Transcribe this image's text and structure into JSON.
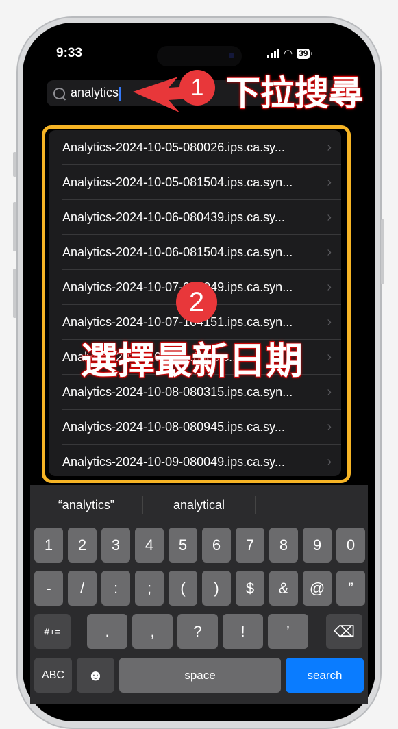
{
  "status_bar": {
    "time": "9:33",
    "battery": "39"
  },
  "search": {
    "value": "analytics"
  },
  "results": [
    "Analytics-2024-10-05-080026.ips.ca.sy...",
    "Analytics-2024-10-05-081504.ips.ca.syn...",
    "Analytics-2024-10-06-080439.ips.ca.sy...",
    "Analytics-2024-10-06-081504.ips.ca.syn...",
    "Analytics-2024-10-07-080049.ips.ca.syn...",
    "Analytics-2024-10-07-104151.ips.ca.syn...",
    "Analytics-2024-10-07-...3.ips.c...",
    "Analytics-2024-10-08-080315.ips.ca.syn...",
    "Analytics-2024-10-08-080945.ips.ca.sy...",
    "Analytics-2024-10-09-080049.ips.ca.sy..."
  ],
  "annotations": {
    "step1_number": "1",
    "step1_label": "下拉搜尋",
    "step2_number": "2",
    "step2_label": "選擇最新日期"
  },
  "keyboard": {
    "suggestions": [
      "“analytics”",
      "analytical",
      ""
    ],
    "row1": [
      "1",
      "2",
      "3",
      "4",
      "5",
      "6",
      "7",
      "8",
      "9",
      "0"
    ],
    "row2": [
      "-",
      "/",
      ":",
      ";",
      "(",
      ")",
      "$",
      "&",
      "@",
      "”"
    ],
    "row3": [
      ".",
      ",",
      "?",
      "!",
      "’"
    ],
    "symbols": "#+=",
    "abc": "ABC",
    "space": "space",
    "search": "search"
  },
  "colors": {
    "highlight": "#f6b425",
    "badge": "#e8373a",
    "search_key": "#0a7cff"
  }
}
